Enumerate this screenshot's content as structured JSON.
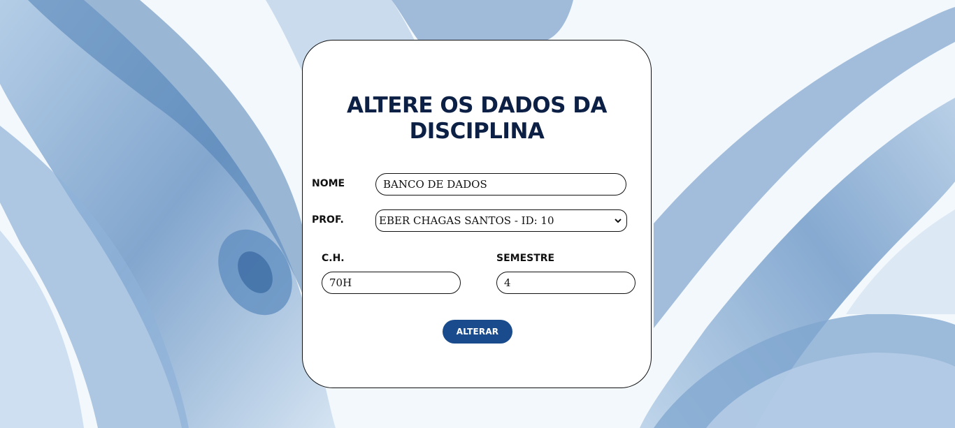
{
  "page": {
    "title_line1": "ALTERE OS DADOS DA",
    "title_line2": "DISCIPLINA"
  },
  "form": {
    "nome": {
      "label": "NOME",
      "value": "BANCO DE DADOS"
    },
    "prof": {
      "label": "PROF.",
      "selected": "EBER CHAGAS SANTOS - ID: 10"
    },
    "ch": {
      "label": "C.H.",
      "value": "70H"
    },
    "semestre": {
      "label": "SEMESTRE",
      "value": "4"
    },
    "submit_label": "ALTERAR"
  },
  "colors": {
    "title": "#0c1f44",
    "button_bg": "#1a4b8c",
    "button_text": "#ffffff",
    "background_accent": "#4f7fb5"
  },
  "icons": {
    "select_arrow": "chevron-down-icon"
  }
}
